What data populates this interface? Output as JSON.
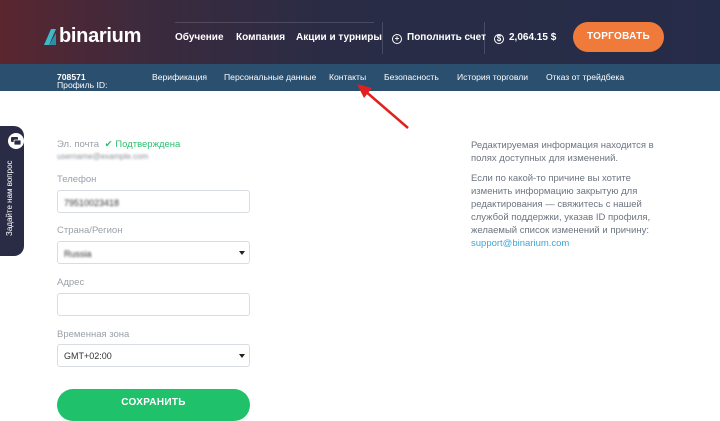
{
  "header": {
    "logo_text": "binarium",
    "nav": [
      "Обучение",
      "Компания",
      "Акции и турниры"
    ],
    "deposit_label": "Пополнить счет",
    "balance": "2,064.15 $",
    "trade_label": "ТОРГОВАТЬ"
  },
  "subnav": {
    "profile_label": "Профиль ID:",
    "profile_id": "708571",
    "items": [
      "Верификация",
      "Персональные данные",
      "Контакты",
      "Безопасность",
      "История торговли",
      "Отказ от трейдбека"
    ],
    "active": "Контакты"
  },
  "side_tab": {
    "label": "Задайте нам вопрос"
  },
  "form": {
    "email_label": "Эл. почта",
    "email_status": "Подтверждена",
    "email_value": "username@example.com",
    "phone_label": "Телефон",
    "phone_value": "79510023418",
    "country_label": "Страна/Регион",
    "country_value": "Russia",
    "address_label": "Адрес",
    "address_value": "",
    "timezone_label": "Временная зона",
    "timezone_value": "GMT+02:00",
    "save_label": "СОХРАНИТЬ"
  },
  "info": {
    "p1": "Редактируемая информация находится в полях доступных для изменений.",
    "p2": "Если по какой-то причине вы хотите изменить информацию закрытую для редактирования — свяжитесь с нашей службой поддержки, указав ID профиля, желаемый список изменений и причину:",
    "support_email": "support@binarium.com"
  },
  "colors": {
    "accent_orange": "#f07a3a",
    "save_green": "#1fc26a",
    "subnav_blue": "#2a4f6f",
    "link_blue": "#3ea6d9",
    "annotation_red": "#e02020"
  }
}
